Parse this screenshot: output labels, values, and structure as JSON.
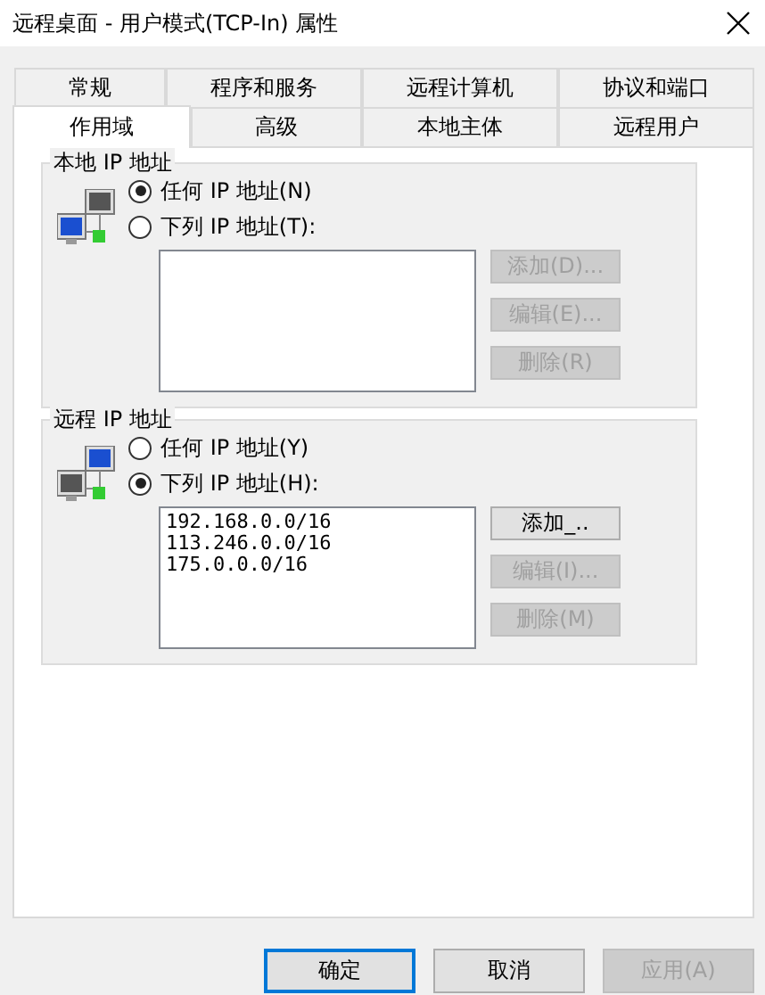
{
  "window": {
    "title": "远程桌面 - 用户模式(TCP-In) 属性"
  },
  "tab_rows": [
    [
      {
        "label": "常规",
        "selected": false
      },
      {
        "label": "程序和服务",
        "selected": false
      },
      {
        "label": "远程计算机",
        "selected": false
      },
      {
        "label": "协议和端口",
        "selected": false
      }
    ],
    [
      {
        "label": "作用域",
        "selected": true
      },
      {
        "label": "高级",
        "selected": false
      },
      {
        "label": "本地主体",
        "selected": false
      },
      {
        "label": "远程用户",
        "selected": false
      }
    ]
  ],
  "groups": [
    {
      "title": "本地 IP 地址",
      "kind": "local",
      "options": [
        {
          "label": "任何 IP 地址(N)",
          "selected": true
        },
        {
          "label": "下列 IP 地址(T):",
          "selected": false
        }
      ],
      "buttons": [
        {
          "label": "添加(D)...",
          "disabled": true
        },
        {
          "label": "编辑(E)...",
          "disabled": true
        },
        {
          "label": "删除(R)",
          "disabled": true
        }
      ]
    },
    {
      "title": "远程 IP 地址",
      "kind": "remote",
      "options": [
        {
          "label": "任何 IP 地址(Y)",
          "selected": false
        },
        {
          "label": "下列 IP 地址(H):",
          "selected": true
        }
      ],
      "addresses": [
        "192.168.0.0/16",
        "113.246.0.0/16",
        "175.0.0.0/16"
      ],
      "buttons": [
        {
          "label": "添加_..",
          "disabled": false
        },
        {
          "label": "编辑(I)...",
          "disabled": true
        },
        {
          "label": "删除(M)",
          "disabled": true
        }
      ]
    }
  ],
  "footer_buttons": [
    {
      "label": "确定",
      "default": true,
      "disabled": false
    },
    {
      "label": "取消",
      "default": false,
      "disabled": false
    },
    {
      "label": "应用(A)",
      "default": false,
      "disabled": true
    }
  ]
}
